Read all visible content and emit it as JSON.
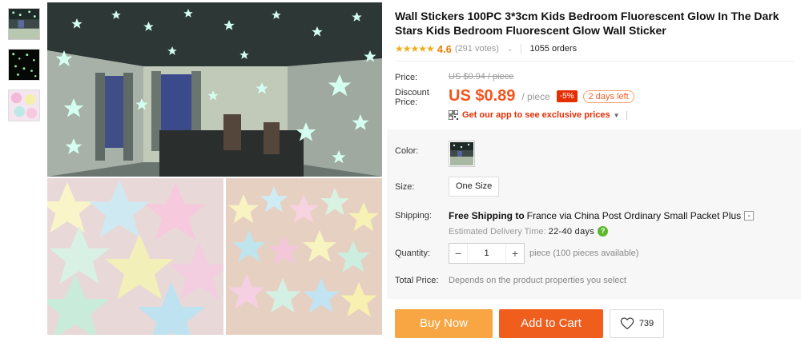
{
  "product": {
    "title": "Wall Stickers 100PC 3*3cm Kids Bedroom Fluorescent Glow In The Dark Stars Kids Bedroom Fluorescent Glow Wall Sticker",
    "rating_stars": "★★★★★",
    "rating": "4.6",
    "votes": "(291 votes)",
    "orders": "1055 orders"
  },
  "price": {
    "label": "Price:",
    "original": "US $0.94 / piece",
    "discount_label": "Discount Price:",
    "current": "US $0.89",
    "unit": "/ piece",
    "discount_badge": "-5%",
    "days_left": "2 days left",
    "app_promo": "Get our app to see exclusive prices"
  },
  "options": {
    "color_label": "Color:",
    "size_label": "Size:",
    "size_value": "One Size",
    "shipping_label": "Shipping:",
    "shipping_free": "Free Shipping to",
    "shipping_route": "France via China Post Ordinary Small Packet Plus",
    "delivery_label": "Estimated Delivery Time:",
    "delivery_days": "22-40 days",
    "quantity_label": "Quantity:",
    "quantity_value": "1",
    "quantity_note": "piece (100 pieces available)",
    "total_label": "Total Price:",
    "total_note": "Depends on the product properties you select"
  },
  "actions": {
    "buy_now": "Buy Now",
    "add_to_cart": "Add to Cart",
    "wishlist_count": "739"
  },
  "icons": {
    "rating": "star-icon",
    "qr": "qr-code-icon",
    "help": "help-check-icon",
    "wishlist": "heart-icon"
  },
  "colors": {
    "accent_orange": "#f05e1e",
    "buy_now": "#f7a643",
    "price_red": "#f5541c",
    "rating": "#f0ad1c"
  }
}
